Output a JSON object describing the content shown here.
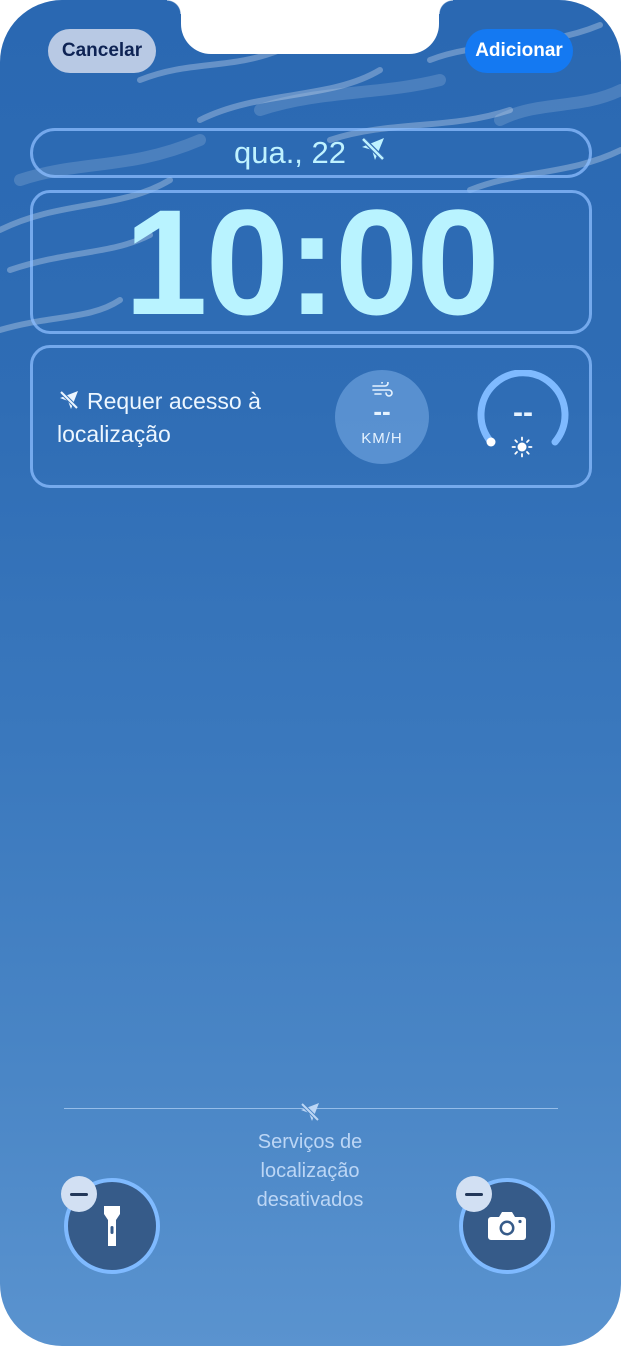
{
  "header": {
    "cancel_label": "Cancelar",
    "add_label": "Adicionar"
  },
  "lockscreen": {
    "date_text": "qua., 22",
    "time_text": "10:00"
  },
  "widgets": {
    "location_required_text": "Requer acesso à localização",
    "wind": {
      "value": "--",
      "unit": "KM/H"
    },
    "uv": {
      "value": "--"
    }
  },
  "bottom": {
    "location_status_text": "Serviços de localização desativados",
    "quick_actions": [
      "flashlight-icon",
      "camera-icon"
    ]
  },
  "colors": {
    "accent": "#1479f2",
    "time_text": "#b9f3ff",
    "background_top": "#2a68b2",
    "background_bottom": "#5a93cf"
  }
}
